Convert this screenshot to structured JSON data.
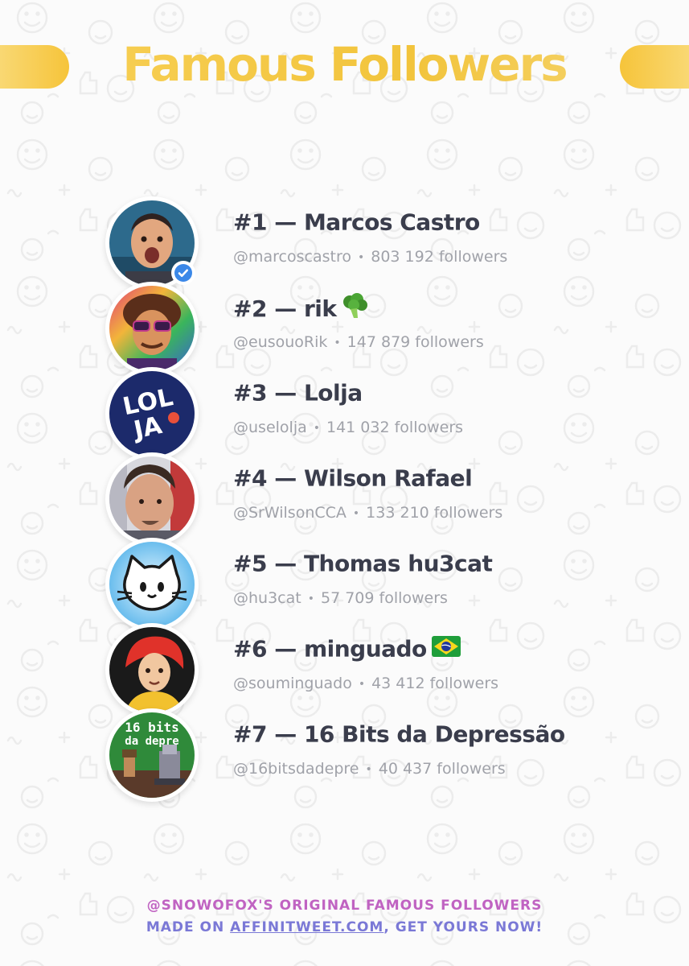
{
  "title": "Famous Followers",
  "colors": {
    "title_gold": "#f4c84a",
    "name_text": "#3a3d4c",
    "meta_text": "#a0a2a9",
    "footer_pink": "#c063c2",
    "footer_purple": "#7a78d6",
    "verified_blue": "#3b88e8"
  },
  "followers": [
    {
      "rank_name": "#1 — Marcos Castro",
      "handle": "@marcoscastro",
      "followers": "803 192 followers",
      "verified": true,
      "avatar_icon": "photo-man-surprised-avatar"
    },
    {
      "rank_name": "#2 — rik",
      "emoji": "broccoli-emoji",
      "handle": "@eusouoRik",
      "followers": "147 879 followers",
      "avatar_icon": "cartoon-sunglasses-avatar"
    },
    {
      "rank_name": "#3 — Lolja",
      "handle": "@uselolja",
      "followers": "141 032 followers",
      "avatar_icon": "lolja-logo-avatar"
    },
    {
      "rank_name": "#4 — Wilson Rafael",
      "handle": "@SrWilsonCCA",
      "followers": "133 210 followers",
      "avatar_icon": "photo-man-avatar"
    },
    {
      "rank_name": "#5 — Thomas hu3cat",
      "handle": "@hu3cat",
      "followers": "57 709 followers",
      "avatar_icon": "cat-face-avatar"
    },
    {
      "rank_name": "#6 — minguado",
      "emoji": "brazil-flag-emoji",
      "handle": "@souminguado",
      "followers": "43 412 followers",
      "avatar_icon": "cartoon-redhair-avatar"
    },
    {
      "rank_name": "#7 — 16 Bits da Depressão",
      "handle": "@16bitsdadepre",
      "followers": "40 437 followers",
      "avatar_icon": "pixel-art-avatar"
    }
  ],
  "separator": "•",
  "footer": {
    "line1": "@SNOWOFOX'S ORIGINAL FAMOUS FOLLOWERS",
    "line2_prefix": "MADE ON ",
    "line2_link": "AFFINITWEET.COM",
    "line2_suffix": ", GET YOURS NOW!"
  },
  "avatar_texts": {
    "lolja_top": "LOL",
    "lolja_bottom": "JA",
    "pixel_line1": "16 bits",
    "pixel_line2": "da depre"
  }
}
